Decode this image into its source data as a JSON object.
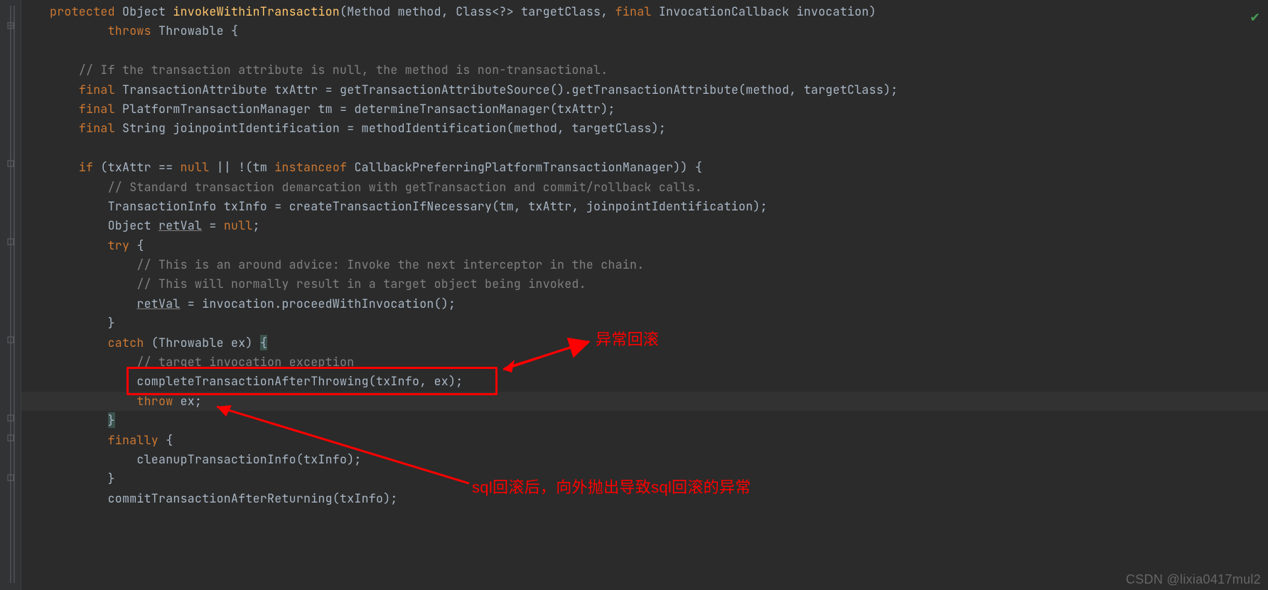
{
  "code": {
    "l1": {
      "a": "protected ",
      "b": "Object ",
      "c": "invokeWithinTransaction",
      "d": "(Method method, Class<?> targetClass, ",
      "e": "final ",
      "f": "InvocationCallback invocation)"
    },
    "l2": {
      "a": "throws ",
      "b": "Throwable {"
    },
    "l3": "",
    "l4": "// If the transaction attribute is null, the method is non-transactional.",
    "l5": {
      "a": "final ",
      "b": "TransactionAttribute txAttr = getTransactionAttributeSource().getTransactionAttribute(method, targetClass);"
    },
    "l6": {
      "a": "final ",
      "b": "PlatformTransactionManager tm = determineTransactionManager(txAttr);"
    },
    "l7": {
      "a": "final ",
      "b": "String joinpointIdentification = methodIdentification(method, targetClass);"
    },
    "l8": "",
    "l9": {
      "a": "if ",
      "b": "(txAttr == ",
      "c": "null ",
      "d": "|| !(tm ",
      "e": "instanceof ",
      "f": "CallbackPreferringPlatformTransactionManager)) {"
    },
    "l10": "// Standard transaction demarcation with getTransaction and commit/rollback calls.",
    "l11": "TransactionInfo txInfo = createTransactionIfNecessary(tm, txAttr, joinpointIdentification);",
    "l12": {
      "a": "Object ",
      "b": "retVal",
      "c": " = ",
      "d": "null",
      "e": ";"
    },
    "l13": {
      "a": "try ",
      "b": "{"
    },
    "l14": "// This is an around advice: Invoke the next interceptor in the chain.",
    "l15": "// This will normally result in a target object being invoked.",
    "l16": {
      "a": "retVal",
      "b": " = invocation.proceedWithInvocation();"
    },
    "l17": "}",
    "l18": {
      "a": "catch ",
      "b": "(Throwable ex) ",
      "c": "{"
    },
    "l19": "// target invocation exception",
    "l20": "completeTransactionAfterThrowing(txInfo, ex);",
    "l21": {
      "a": "throw ",
      "b": "ex;"
    },
    "l22": "}",
    "l23": {
      "a": "finally ",
      "b": "{"
    },
    "l24": "cleanupTransactionInfo(txInfo);",
    "l25": "}",
    "l26": "commitTransactionAfterReturning(txInfo);"
  },
  "annotations": {
    "label1": "异常回滚",
    "label2": "sql回滚后，向外抛出导致sql回滚的异常"
  },
  "watermark": "CSDN @lixia0417mul2",
  "colors": {
    "keyword": "#cc7832",
    "method": "#ffc66d",
    "comment": "#808080",
    "text": "#a9b7c6",
    "annotation": "#ff0000",
    "background": "#2b2b2b"
  }
}
